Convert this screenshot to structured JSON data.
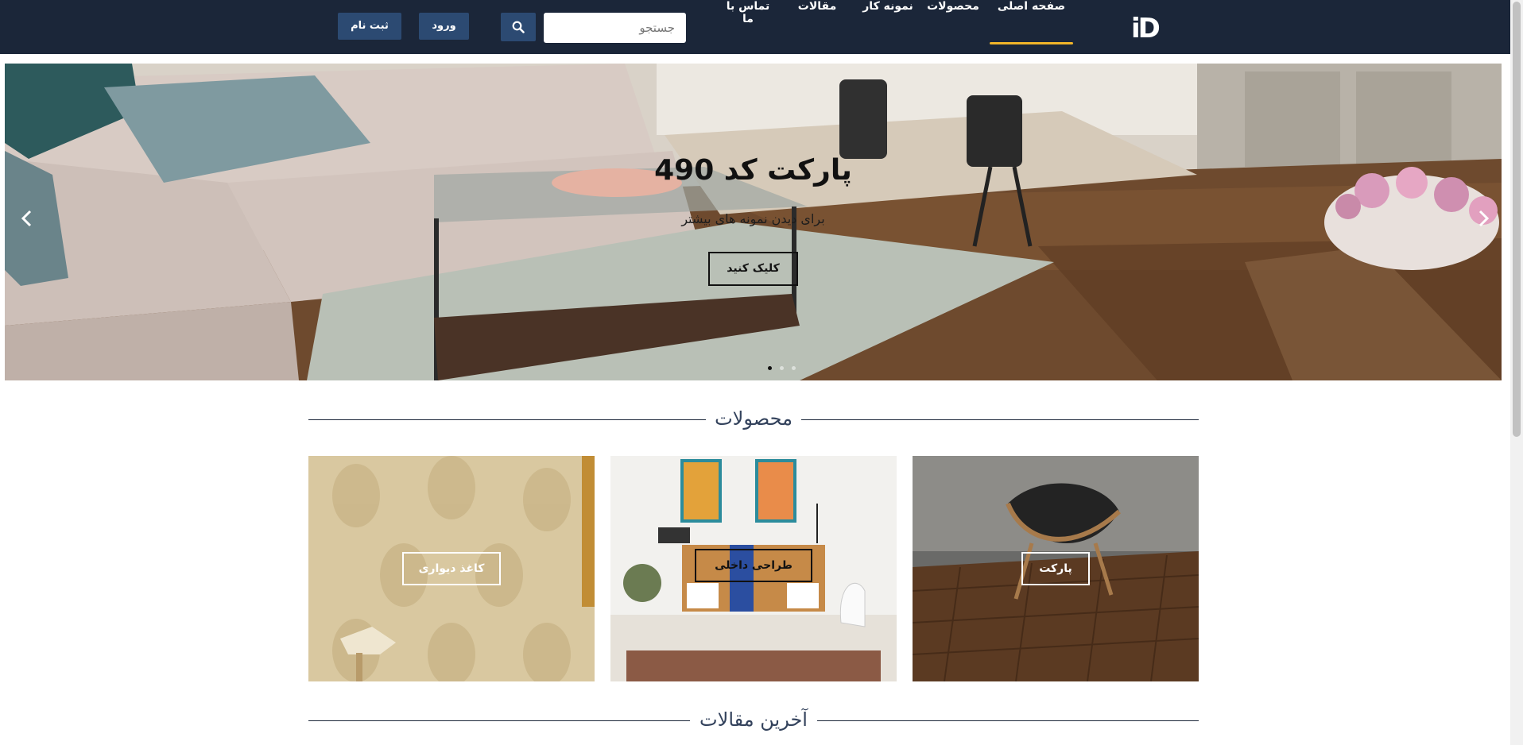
{
  "nav": {
    "logo": "iD",
    "items": [
      {
        "label": "صفحه اصلی",
        "active": true
      },
      {
        "label": "محصولات",
        "active": false
      },
      {
        "label": "نمونه کار",
        "active": false
      },
      {
        "label": "مقالات",
        "active": false
      },
      {
        "label": "تماس با ما",
        "active": false
      }
    ],
    "search_placeholder": "جستجو",
    "login_label": "ورود",
    "register_label": "ثبت نام"
  },
  "slider": {
    "title": "پارکت کد 490",
    "subtitle": "برای دیدن نمونه های بیشتر",
    "button_label": "کلیک کنید",
    "active_index": 0,
    "slide_count": 3
  },
  "products": {
    "heading": "محصولات",
    "items": [
      {
        "label": "پارکت"
      },
      {
        "label": "طراحی داخلی"
      },
      {
        "label": "کاغذ دیواری"
      }
    ]
  },
  "articles": {
    "heading": "آخرین مقالات"
  },
  "colors": {
    "navbar_bg": "#1b2639",
    "accent": "#f0b429",
    "button_bg": "#2c4a72"
  }
}
